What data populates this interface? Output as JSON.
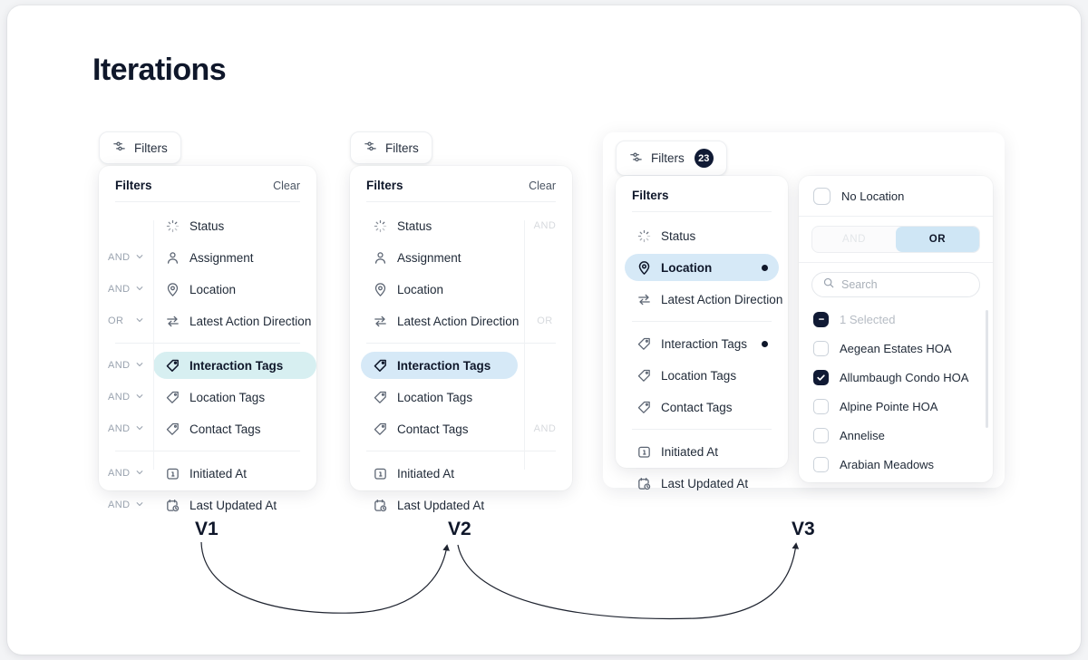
{
  "page": {
    "title": "Iterations"
  },
  "common": {
    "filters_label": "Filters",
    "clear_label": "Clear",
    "card_title": "Filters",
    "filter_icon": "sliders-icon",
    "chevron": "⌄"
  },
  "v1": {
    "label": "V1",
    "pill": {
      "label": "Filters"
    },
    "card": {
      "title": "Filters",
      "clear": "Clear"
    },
    "groups": [
      {
        "rows": [
          {
            "conj": "",
            "icon": "status-spinner-icon",
            "label": "Status",
            "selected": false
          },
          {
            "conj": "AND",
            "icon": "person-icon",
            "label": "Assignment",
            "selected": false
          },
          {
            "conj": "AND",
            "icon": "map-pin-icon",
            "label": "Location",
            "selected": false
          },
          {
            "conj": "OR",
            "icon": "arrows-exchange-icon",
            "label": "Latest Action Direction",
            "selected": false
          }
        ]
      },
      {
        "rows": [
          {
            "conj": "AND",
            "icon": "tag-icon",
            "label": "Interaction Tags",
            "selected": true
          },
          {
            "conj": "AND",
            "icon": "tag-icon",
            "label": "Location Tags",
            "selected": false
          },
          {
            "conj": "AND",
            "icon": "tag-icon",
            "label": "Contact Tags",
            "selected": false
          }
        ]
      },
      {
        "rows": [
          {
            "conj": "AND",
            "icon": "calendar-icon",
            "label": "Initiated At",
            "selected": false
          },
          {
            "conj": "AND",
            "icon": "calendar-clock-icon",
            "label": "Last Updated At",
            "selected": false
          }
        ]
      }
    ]
  },
  "v2": {
    "label": "V2",
    "pill": {
      "label": "Filters"
    },
    "card": {
      "title": "Filters",
      "clear": "Clear"
    },
    "groups": [
      {
        "rows": [
          {
            "icon": "status-spinner-icon",
            "label": "Status",
            "selected": false,
            "conj_right": "AND"
          },
          {
            "icon": "person-icon",
            "label": "Assignment",
            "selected": false,
            "conj_right": ""
          },
          {
            "icon": "map-pin-icon",
            "label": "Location",
            "selected": false,
            "conj_right": ""
          },
          {
            "icon": "arrows-exchange-icon",
            "label": "Latest Action Direction",
            "selected": false,
            "conj_right": "OR"
          }
        ]
      },
      {
        "rows": [
          {
            "icon": "tag-icon",
            "label": "Interaction Tags",
            "selected": true,
            "conj_right": ""
          },
          {
            "icon": "tag-icon",
            "label": "Location Tags",
            "selected": false,
            "conj_right": ""
          },
          {
            "icon": "tag-icon",
            "label": "Contact Tags",
            "selected": false,
            "conj_right": "AND"
          }
        ]
      },
      {
        "rows": [
          {
            "icon": "calendar-icon",
            "label": "Initiated At",
            "selected": false,
            "conj_right": ""
          },
          {
            "icon": "calendar-clock-icon",
            "label": "Last Updated At",
            "selected": false,
            "conj_right": ""
          }
        ]
      }
    ]
  },
  "v3": {
    "label": "V3",
    "pill": {
      "label": "Filters",
      "badge": "23"
    },
    "card": {
      "title": "Filters"
    },
    "groups": [
      {
        "rows": [
          {
            "icon": "status-spinner-icon",
            "label": "Status",
            "selected": false,
            "dot": false
          },
          {
            "icon": "map-pin-icon",
            "label": "Location",
            "selected": true,
            "dot": true
          },
          {
            "icon": "arrows-exchange-icon",
            "label": "Latest Action Direction",
            "selected": false,
            "dot": false
          }
        ]
      },
      {
        "rows": [
          {
            "icon": "tag-icon",
            "label": "Interaction Tags",
            "selected": false,
            "dot": true
          },
          {
            "icon": "tag-icon",
            "label": "Location Tags",
            "selected": false,
            "dot": false
          },
          {
            "icon": "tag-icon",
            "label": "Contact Tags",
            "selected": false,
            "dot": false
          }
        ]
      },
      {
        "rows": [
          {
            "icon": "calendar-icon",
            "label": "Initiated At",
            "selected": false,
            "dot": false
          },
          {
            "icon": "calendar-clock-icon",
            "label": "Last Updated At",
            "selected": false,
            "dot": false
          }
        ]
      }
    ],
    "detail": {
      "no_location": {
        "label": "No Location",
        "checked": false
      },
      "andor": {
        "and_label": "AND",
        "or_label": "OR",
        "active": "OR"
      },
      "search": {
        "placeholder": "Search",
        "value": "",
        "icon": "search-icon"
      },
      "selected_summary": {
        "label": "1 Selected",
        "state": "indeterminate"
      },
      "options": [
        {
          "label": "Aegean Estates HOA",
          "checked": false
        },
        {
          "label": "Allumbaugh Condo HOA",
          "checked": true
        },
        {
          "label": "Alpine Pointe HOA",
          "checked": false
        },
        {
          "label": "Annelise",
          "checked": false
        },
        {
          "label": "Arabian Meadows",
          "checked": false
        }
      ]
    }
  },
  "colors": {
    "accent_teal": "#d7eff1",
    "accent_blue": "#d6e9f7",
    "toggle_active": "#cfe6f5",
    "badge_navy": "#101a34",
    "text_dark": "#0f172a",
    "muted": "#9aa3af"
  }
}
